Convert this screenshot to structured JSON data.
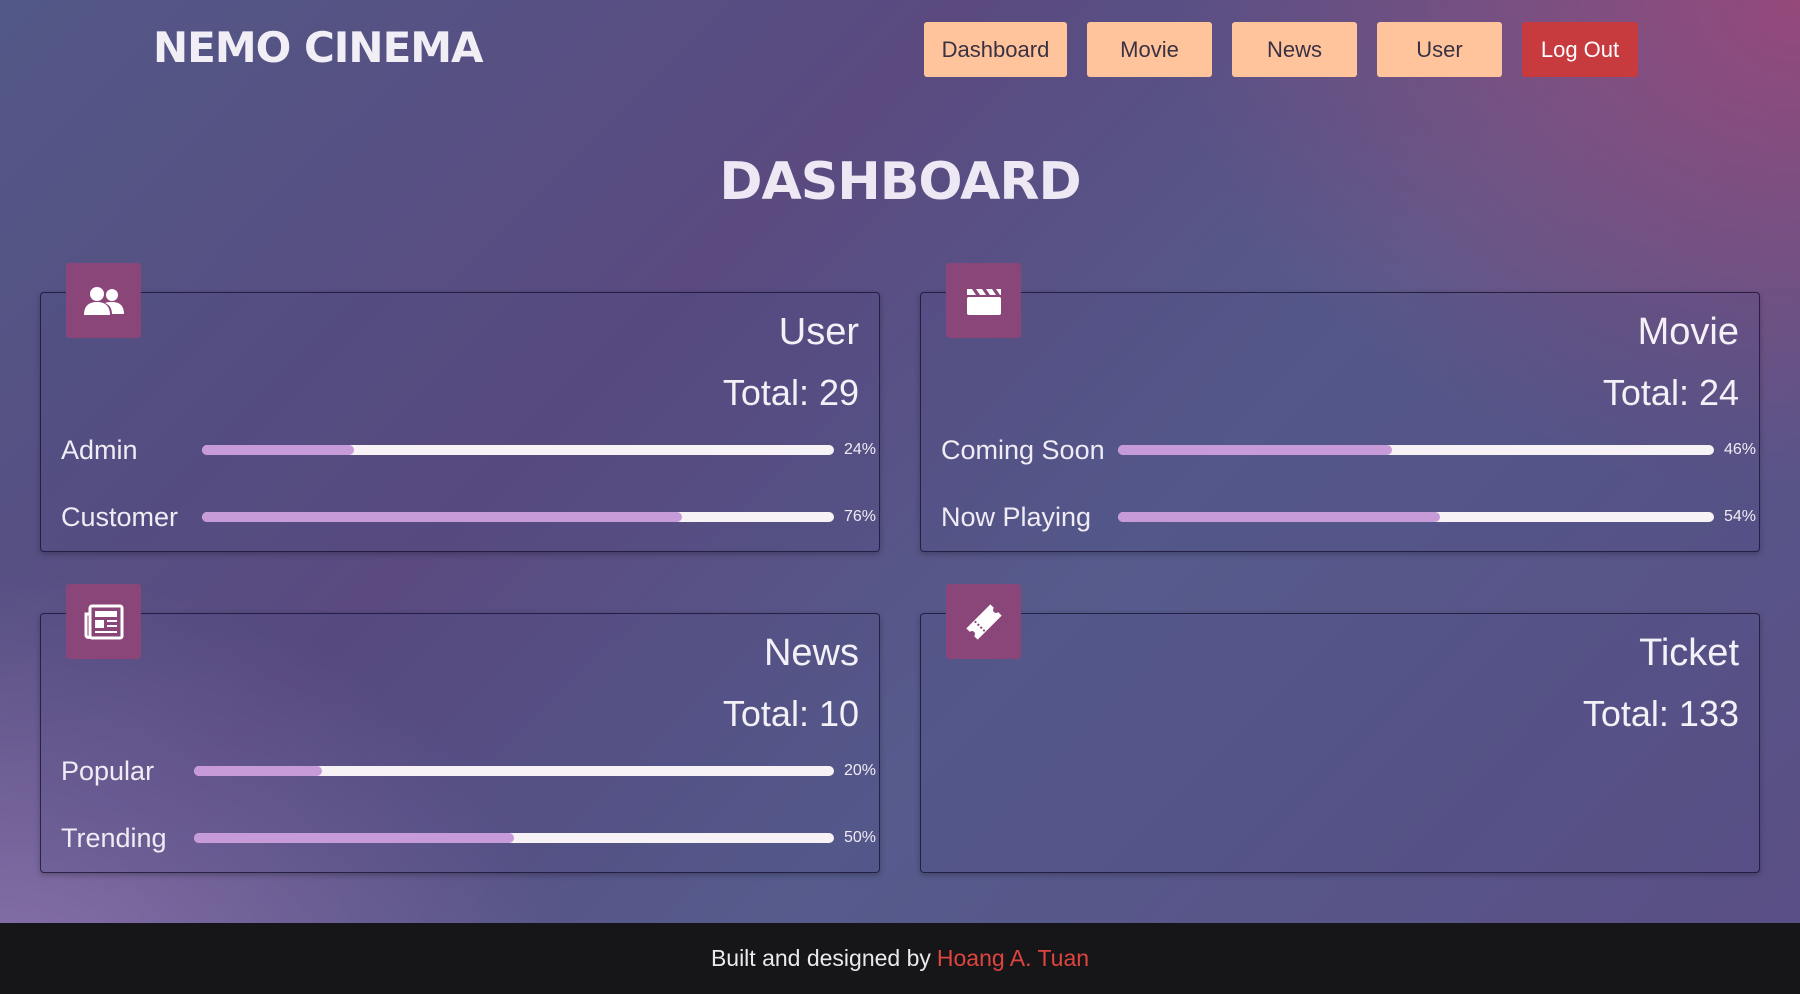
{
  "app": {
    "title": "NEMO CINEMA"
  },
  "nav": {
    "items": [
      {
        "label": "Dashboard"
      },
      {
        "label": "Movie"
      },
      {
        "label": "News"
      },
      {
        "label": "User"
      }
    ],
    "logout": "Log Out"
  },
  "page": {
    "title": "DASHBOARD"
  },
  "cards": {
    "user": {
      "title": "User",
      "total": "Total: 29",
      "icon": "users-icon",
      "stats": [
        {
          "label": "Admin",
          "percent": 24,
          "percent_text": "24%"
        },
        {
          "label": "Customer",
          "percent": 76,
          "percent_text": "76%"
        }
      ]
    },
    "movie": {
      "title": "Movie",
      "total": "Total: 24",
      "icon": "clapperboard-icon",
      "stats": [
        {
          "label": "Coming Soon",
          "percent": 46,
          "percent_text": "46%"
        },
        {
          "label": "Now Playing",
          "percent": 54,
          "percent_text": "54%"
        }
      ]
    },
    "news": {
      "title": "News",
      "total": "Total: 10",
      "icon": "newspaper-icon",
      "stats": [
        {
          "label": "Popular",
          "percent": 20,
          "percent_text": "20%"
        },
        {
          "label": "Trending",
          "percent": 50,
          "percent_text": "50%"
        }
      ]
    },
    "ticket": {
      "title": "Ticket",
      "total": "Total: 133",
      "icon": "ticket-icon"
    }
  },
  "footer": {
    "text": "Built and designed by",
    "author": "Hoang A. Tuan"
  },
  "colors": {
    "nav_button": "#ffc49b",
    "logout_button": "#c73a3d",
    "icon_tile": "#8a4679",
    "bar_fill": "#c79ad8",
    "bar_track": "#f6f2f6",
    "footer_bg": "#161619",
    "author": "#e0443f"
  }
}
